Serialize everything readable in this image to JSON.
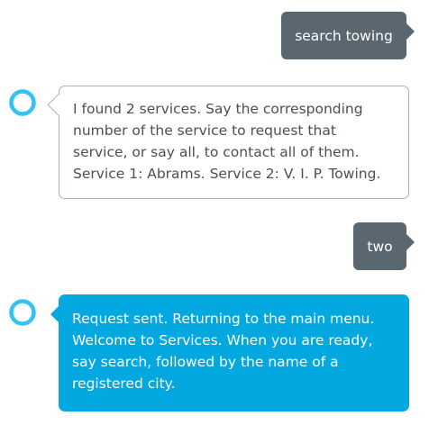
{
  "conversation": {
    "messages": [
      {
        "role": "user",
        "text": "search towing"
      },
      {
        "role": "assistant",
        "text": "I found 2 services. Say the corresponding\nnumber of the service to request that\nservice, or say all, to contact all of them.\nService 1: Abrams. Service 2: V. I. P. Towing."
      },
      {
        "role": "user",
        "text": "two"
      },
      {
        "role": "assistant",
        "text": "Request sent. Returning to the main menu.\nWelcome to Services. When you are ready,\nsay search, followed by the name of a\nregistered city."
      }
    ]
  },
  "icons": {
    "assistant_avatar": "alexa-ring-icon"
  },
  "colors": {
    "user_bubble": "#5b6770",
    "assistant_outline": "#a9b3ba",
    "assistant_filled": "#03a8e0",
    "avatar_ring": "#31c4f3"
  }
}
